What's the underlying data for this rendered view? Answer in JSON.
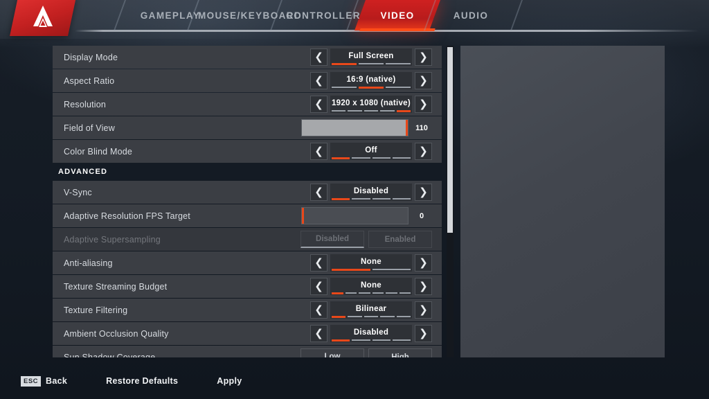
{
  "app": {
    "logo_icon": "apex-legends-logo",
    "accent_color": "#e8481a",
    "tab_active_color": "#c62020"
  },
  "nav": {
    "tabs": [
      {
        "label": "GAMEPLAY",
        "active": false
      },
      {
        "label": "MOUSE/KEYBOARD",
        "active": false
      },
      {
        "label": "CONTROLLER",
        "active": false
      },
      {
        "label": "VIDEO",
        "active": true
      },
      {
        "label": "AUDIO",
        "active": false
      }
    ]
  },
  "settings": {
    "section_header": "ADVANCED",
    "rows": [
      {
        "label": "Display Mode",
        "type": "stepper",
        "value": "Full Screen",
        "segments": 3,
        "selected": 1,
        "disabled": false
      },
      {
        "label": "Aspect Ratio",
        "type": "stepper",
        "value": "16:9 (native)",
        "segments": 3,
        "selected": 2,
        "disabled": false
      },
      {
        "label": "Resolution",
        "type": "stepper",
        "value": "1920 x 1080 (native)",
        "segments": 5,
        "selected": 5,
        "disabled": false
      },
      {
        "label": "Field of View",
        "type": "slider",
        "value": "110",
        "fill_percent": 100,
        "disabled": false
      },
      {
        "label": "Color Blind Mode",
        "type": "stepper",
        "value": "Off",
        "segments": 4,
        "selected": 1,
        "disabled": false
      },
      {
        "label": "V-Sync",
        "type": "stepper",
        "value": "Disabled",
        "segments": 4,
        "selected": 1,
        "disabled": false
      },
      {
        "label": "Adaptive Resolution FPS Target",
        "type": "slider",
        "value": "0",
        "fill_percent": 0,
        "disabled": false
      },
      {
        "label": "Adaptive Supersampling",
        "type": "toggle",
        "options": [
          "Disabled",
          "Enabled"
        ],
        "selected_index": 0,
        "disabled": true
      },
      {
        "label": "Anti-aliasing",
        "type": "stepper",
        "value": "None",
        "segments": 2,
        "selected": 1,
        "disabled": false
      },
      {
        "label": "Texture Streaming Budget",
        "type": "stepper",
        "value": "None",
        "segments": 6,
        "selected": 1,
        "disabled": false
      },
      {
        "label": "Texture Filtering",
        "type": "stepper",
        "value": "Bilinear",
        "segments": 5,
        "selected": 1,
        "disabled": false
      },
      {
        "label": "Ambient Occlusion Quality",
        "type": "stepper",
        "value": "Disabled",
        "segments": 4,
        "selected": 1,
        "disabled": false
      },
      {
        "label": "Sun Shadow Coverage",
        "type": "toggle",
        "options": [
          "Low",
          "High"
        ],
        "selected_index": 0,
        "disabled": false
      }
    ],
    "arrow_left_icon": "chevron-left-icon",
    "arrow_right_icon": "chevron-right-icon"
  },
  "scrollbar": {
    "thumb_percent": 60
  },
  "footer": {
    "items": [
      {
        "key": "ESC",
        "label": "Back"
      },
      {
        "key": "",
        "label": "Restore Defaults"
      },
      {
        "key": "",
        "label": "Apply"
      }
    ]
  }
}
